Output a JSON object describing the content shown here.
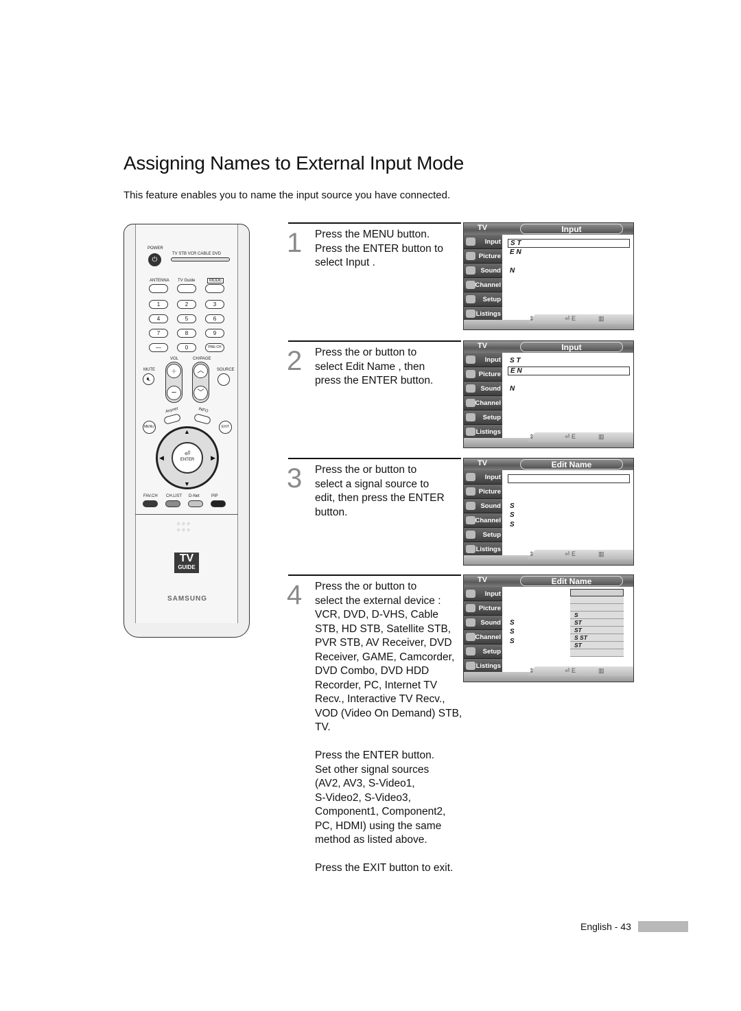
{
  "page": {
    "title": "Assigning Names to External Input Mode",
    "intro": "This feature enables you to name the input source you have connected.",
    "footer": "English - 43"
  },
  "steps": [
    {
      "number": "1",
      "text": "Press the MENU button.\nPress the ENTER button to\nselect  Input ."
    },
    {
      "number": "2",
      "text": "Press the    or      button to\nselect  Edit Name , then\npress the ENTER button."
    },
    {
      "number": "3",
      "text": "Press the    or      button to\nselect a signal source to\nedit, then press the ENTER\nbutton."
    },
    {
      "number": "4",
      "text": "Press the    or      button to\nselect the external device :\nVCR, DVD, D-VHS, Cable\nSTB, HD STB, Satellite STB,\nPVR STB, AV Receiver, DVD\nReceiver, GAME, Camcorder,\nDVD Combo, DVD HDD\nRecorder, PC, Internet TV\nRecv., Interactive TV Recv.,\nVOD (Video On Demand) STB, TV.\n\nPress the ENTER button.\nSet other signal sources\n(AV2, AV3, S-Video1,\nS-Video2, S-Video3,\nComponent1, Component2,\nPC, HDMI) using the same\nmethod as listed above.\n\nPress the EXIT button to exit."
    }
  ],
  "screens": [
    {
      "tv": "TV",
      "title": "Input",
      "rows": [
        {
          "text": "S              T",
          "selected": true
        },
        {
          "text": "E N"
        },
        {
          "text": "    N",
          "gap": true
        }
      ],
      "list": []
    },
    {
      "tv": "TV",
      "title": "Input",
      "rows": [
        {
          "text": "S              T"
        },
        {
          "text": "E N",
          "selected": true
        },
        {
          "text": "    N",
          "gap": true
        }
      ],
      "list": []
    },
    {
      "tv": "TV",
      "title": "Edit Name",
      "rows": [
        {
          "text": "",
          "selected": true
        },
        {
          "text": "S",
          "at": 3
        },
        {
          "text": "S",
          "at": 4
        },
        {
          "text": "S",
          "at": 5
        }
      ],
      "list": []
    },
    {
      "tv": "TV",
      "title": "Edit Name",
      "rows": [
        {
          "text": "S",
          "at": 3
        },
        {
          "text": "S",
          "at": 4
        },
        {
          "text": "S",
          "at": 5
        }
      ],
      "list": [
        "",
        "",
        "",
        "    S",
        " ST",
        "    ST",
        "S  ST",
        "    ST",
        ""
      ]
    }
  ],
  "screen_menu": [
    "Input",
    "Picture",
    "Sound",
    "Channel",
    "Setup",
    "Listings"
  ],
  "screen_footer_icons": [
    "updown-icon",
    "enter-icon",
    "menu-icon"
  ],
  "remote": {
    "power": "POWER",
    "modes": "TV  STB  VCR  CABLE  DVD",
    "antenna": "ANTENNA",
    "tvguide": "TV Guide",
    "mode": "MODE",
    "keys": [
      "1",
      "2",
      "3",
      "4",
      "5",
      "6",
      "7",
      "8",
      "9",
      "—",
      "0",
      "PRE-CH"
    ],
    "vol": "VOL",
    "chpage": "CH/PAGE",
    "mute": "MUTE",
    "source": "SOURCE",
    "anynet": "Anynet",
    "info": "INFO",
    "menu": "MENU",
    "exit": "EXIT",
    "enter": "ENTER",
    "color_buttons": [
      {
        "label": "FAV.CH",
        "color": "#3a3a3a"
      },
      {
        "label": "CH.LIST",
        "color": "#8c8c8c"
      },
      {
        "label": "D-Net",
        "color": "#c4c4c4"
      },
      {
        "label": "PIP",
        "color": "#222222"
      }
    ],
    "logo_tv": "TV",
    "logo_guide": "GUIDE",
    "brand": "SAMSUNG"
  }
}
